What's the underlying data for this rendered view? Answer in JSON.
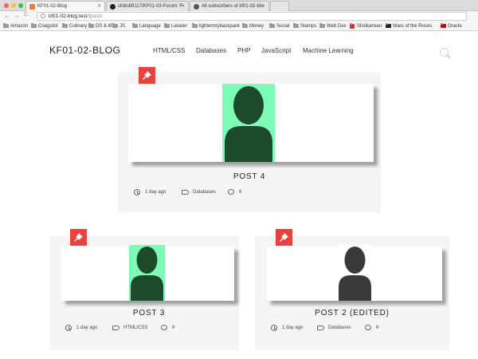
{
  "browser": {
    "tabs": [
      {
        "title": "KF01-02-Blog",
        "favicon_color": "#f07a28"
      },
      {
        "title": "chilin89117/KF01-03-Forum: F",
        "favicon_color": "#222222"
      },
      {
        "title": "All subscribers of kf01-02-blo",
        "favicon_color": "#333333"
      }
    ],
    "url_host": "kf01-02-blog.test",
    "url_path": "/fposts",
    "back_glyph": "←",
    "forward_glyph": "→",
    "reload_glyph": "C",
    "bookmarks": [
      "Amazon",
      "Craigslist",
      "Culinary",
      "DS & ML",
      "JS",
      "Language",
      "Laravel",
      "lightenmybackpack",
      "Money",
      "Social",
      "Stamps",
      "Web Dev",
      "Shinkansen",
      "Wars of the Roses",
      "Oracle"
    ]
  },
  "site": {
    "logo": "KF01-02-BLOG",
    "nav": [
      "HTML/CSS",
      "Databases",
      "PHP",
      "JavaScript",
      "Machine Learning"
    ]
  },
  "posts": [
    {
      "title": "POST 4",
      "time": "1 day ago",
      "category": "Databases",
      "comments": "6",
      "image_bg": "#7cfcb4",
      "avatar_color": "#1e4a2c"
    },
    {
      "title": "POST 3",
      "time": "1 day ago",
      "category": "HTML/CSS",
      "comments": "6",
      "image_bg": "#7cfcb4",
      "avatar_color": "#1e4a2c"
    },
    {
      "title": "POST 2 (EDITED)",
      "time": "1 day ago",
      "category": "Databases",
      "comments": "6",
      "image_bg": "#ffffff",
      "avatar_color": "#3a3a3a"
    }
  ],
  "colors": {
    "pin": "#e8413e",
    "card_bg": "#f4f5f4"
  }
}
